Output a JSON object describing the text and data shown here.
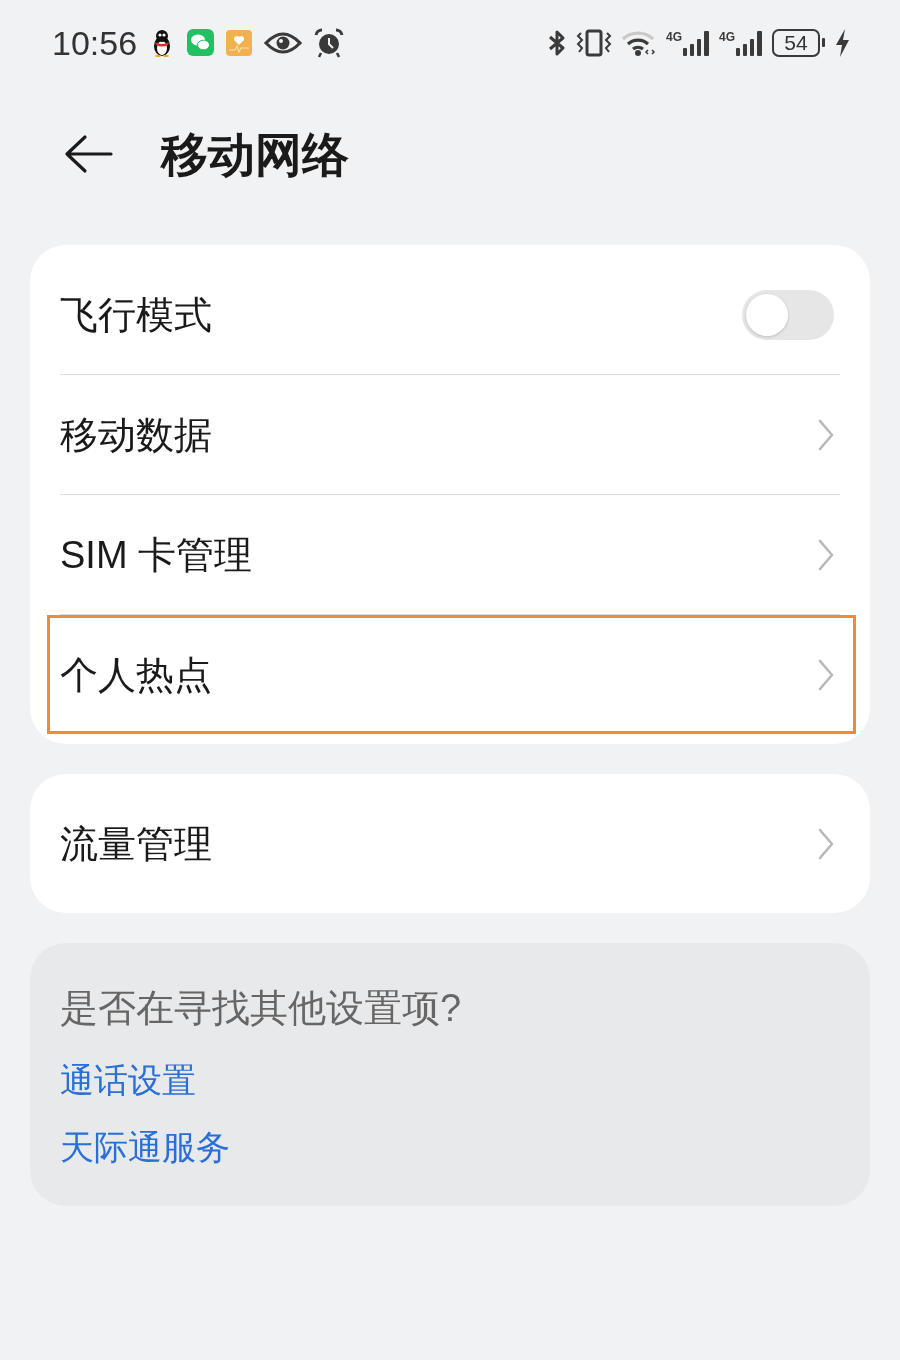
{
  "status_bar": {
    "time": "10:56",
    "signals": [
      {
        "network": "4G"
      },
      {
        "network": "4G"
      }
    ],
    "battery": "54"
  },
  "header": {
    "title": "移动网络"
  },
  "groups": [
    {
      "items": [
        {
          "kind": "switch",
          "label": "飞行模式",
          "on": false,
          "highlighted": false
        },
        {
          "kind": "link",
          "label": "移动数据",
          "highlighted": false
        },
        {
          "kind": "link",
          "label": "SIM 卡管理",
          "highlighted": false
        },
        {
          "kind": "link",
          "label": "个人热点",
          "highlighted": true
        }
      ]
    },
    {
      "items": [
        {
          "kind": "link",
          "label": "流量管理",
          "highlighted": false
        }
      ]
    }
  ],
  "suggestions": {
    "title": "是否在寻找其他设置项?",
    "links": [
      "通话设置",
      "天际通服务"
    ]
  }
}
